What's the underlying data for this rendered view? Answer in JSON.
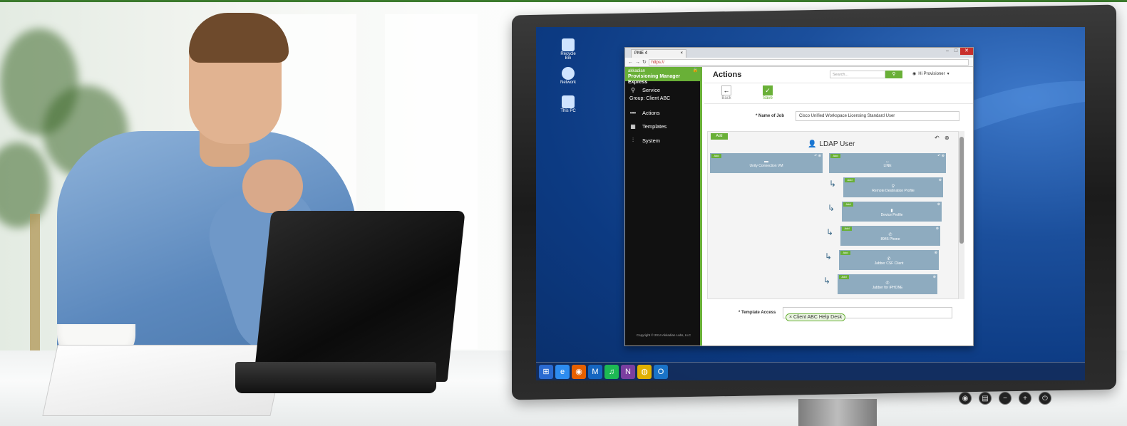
{
  "desktop": {
    "icons": [
      {
        "label": "Recycle Bin",
        "icon": "recycle-bin-icon"
      },
      {
        "label": "Network",
        "icon": "network-icon"
      },
      {
        "label": "This PC",
        "icon": "computer-icon"
      }
    ],
    "taskbar": [
      {
        "icon": "start-icon",
        "glyph": "⊞"
      },
      {
        "icon": "internet-explorer-icon",
        "glyph": "e"
      },
      {
        "icon": "firefox-icon",
        "glyph": "◉"
      },
      {
        "icon": "mail-icon",
        "glyph": "M"
      },
      {
        "icon": "spotify-icon",
        "glyph": "♫"
      },
      {
        "icon": "onenote-icon",
        "glyph": "N"
      },
      {
        "icon": "chrome-icon",
        "glyph": "◍"
      },
      {
        "icon": "outlook-icon",
        "glyph": "O"
      }
    ],
    "monitor_buttons": [
      {
        "icon": "eye-icon",
        "glyph": "◉"
      },
      {
        "icon": "menu-icon",
        "glyph": "▤"
      },
      {
        "icon": "minus-icon",
        "glyph": "−"
      },
      {
        "icon": "plus-icon",
        "glyph": "+"
      },
      {
        "icon": "power-icon",
        "glyph": "⏻"
      }
    ]
  },
  "browser": {
    "tab_title": "PME 4",
    "tab_close": "×",
    "url": "https://",
    "window_controls": {
      "minimize": "–",
      "maximize": "□",
      "close": "✕"
    }
  },
  "app": {
    "brand_line1": "akkadian",
    "brand_line2": "Provisioning Manager Express",
    "sidebar": {
      "service_label": "Service",
      "group_label": "Group: Client ABC",
      "items": [
        {
          "label": "Actions",
          "icon": "dots-icon"
        },
        {
          "label": "Templates",
          "icon": "templates-icon"
        },
        {
          "label": "System",
          "icon": "sliders-icon"
        }
      ],
      "copyright": "Copyright © 2014 Akkadian Labs, LLC"
    },
    "header": {
      "title": "Actions",
      "search_placeholder": "Search...",
      "user_greeting": "Hi Provisioner"
    },
    "toolbar": {
      "back_label": "Back",
      "save_label": "Save"
    },
    "form": {
      "job_label": "* Name of Job",
      "job_value": "Cisco Unified Workspace Licensing Standard User",
      "template_access_label": "* Template Access",
      "template_access_chip": "× Client ABC Help Desk"
    },
    "panel": {
      "add_label": "Add",
      "title": "LDAP User",
      "card_add_label": "Add",
      "left_card": "Unity Connection VM",
      "right_card": "LINE",
      "children": [
        "Remote Destination Profile",
        "Device Profile",
        "8945 Phone",
        "Jabber CSF Client",
        "Jabber for iPHONE"
      ]
    }
  },
  "colors": {
    "accent": "#69b037",
    "card": "#8eabbf",
    "sidebar": "#111111"
  }
}
